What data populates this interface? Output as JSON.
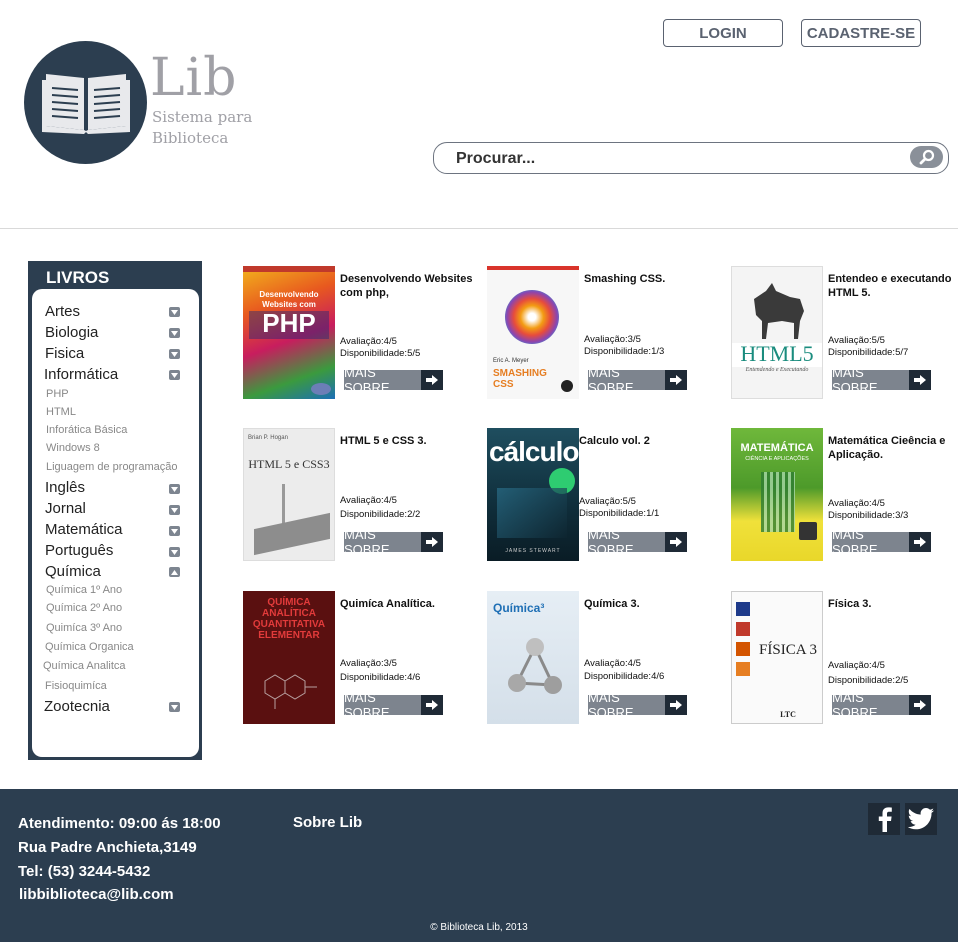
{
  "header": {
    "logo_title": "Lib",
    "logo_subtitle_1": "Sistema para",
    "logo_subtitle_2": "Biblioteca",
    "login_label": "LOGIN",
    "signup_label": "CADASTRE-SE",
    "search_placeholder": "Procurar..."
  },
  "sidebar": {
    "title": "LIVROS",
    "categories": [
      {
        "label": "Artes"
      },
      {
        "label": "Biologia"
      },
      {
        "label": "Fisica"
      },
      {
        "label": "Informática",
        "subitems": [
          "PHP",
          "HTML",
          "Inforática Básica",
          "Windows 8",
          "Liguagem de programação"
        ]
      },
      {
        "label": "Inglês"
      },
      {
        "label": "Jornal"
      },
      {
        "label": "Matemática"
      },
      {
        "label": "Português"
      },
      {
        "label": "Química",
        "subitems": [
          "Química 1º Ano",
          "Química 2º Ano",
          "Quimíca 3º Ano",
          "Química Organica",
          "Química Analitca",
          "Fisioquimíca"
        ]
      },
      {
        "label": "Zootecnia"
      }
    ]
  },
  "books": [
    {
      "title": "Desenvolvendo Websites com php,",
      "rating": "Avaliação:4/5",
      "availability": "Disponibilidade:5/5",
      "cover_text": "PHP",
      "cover_top": "Desenvolvendo Websites com"
    },
    {
      "title": "Smashing CSS.",
      "rating": "Avaliação:3/5",
      "availability": "Disponibilidade:1/3",
      "cover_text": "SMASHING CSS",
      "cover_top": "Eric A. Meyer"
    },
    {
      "title": "Entendeo e executando HTML 5.",
      "rating": "Avaliação:5/5",
      "availability": "Disponibilidade:5/7",
      "cover_text": "HTML5",
      "cover_top": "Entendendo e Executando"
    },
    {
      "title": "HTML 5 e CSS 3.",
      "rating": "Avaliação:4/5",
      "availability": "Disponibilidade:2/2",
      "cover_text": "HTML 5 e CSS3",
      "cover_top": "Brian P. Hogan"
    },
    {
      "title": "Calculo vol. 2",
      "rating": "Avaliação:5/5",
      "availability": "Disponibilidade:1/1",
      "cover_text": "cálculo",
      "cover_top": "JAMES STEWART"
    },
    {
      "title": "Matemática Cieência e Aplicação.",
      "rating": "Avaliação:4/5",
      "availability": "Disponibilidade:3/3",
      "cover_text": "MATEMÁTICA",
      "cover_top": "CIÊNCIA E APLICAÇÕES"
    },
    {
      "title": "Quimíca Analítica.",
      "rating": "Avaliação:3/5",
      "availability": "Disponibilidade:4/6",
      "cover_text": "QUÍMICA ANALÍTICA QUANTITATIVA ELEMENTAR",
      "cover_top": ""
    },
    {
      "title": "Química 3.",
      "rating": "Avaliação:4/5",
      "availability": "Disponibilidade:4/6",
      "cover_text": "Química³",
      "cover_top": ""
    },
    {
      "title": "Física 3.",
      "rating": "Avaliação:4/5",
      "availability": "Disponibilidade:2/5",
      "cover_text": "FÍSICA 3",
      "cover_top": "LTC"
    }
  ],
  "more_label": "MAIS SOBRE",
  "footer": {
    "hours": "Atendimento: 09:00 ás 18:00",
    "address": "Rua Padre Anchieta,3149",
    "phone": "Tel: (53) 3244-5432",
    "email": "libbiblioteca@lib.com",
    "about": "Sobre Lib",
    "copyright": "© Biblioteca Lib, 2013"
  },
  "colors": {
    "primary": "#2c3e50",
    "button_gray": "#7d848e",
    "logo_gray": "#a0a0a6"
  }
}
